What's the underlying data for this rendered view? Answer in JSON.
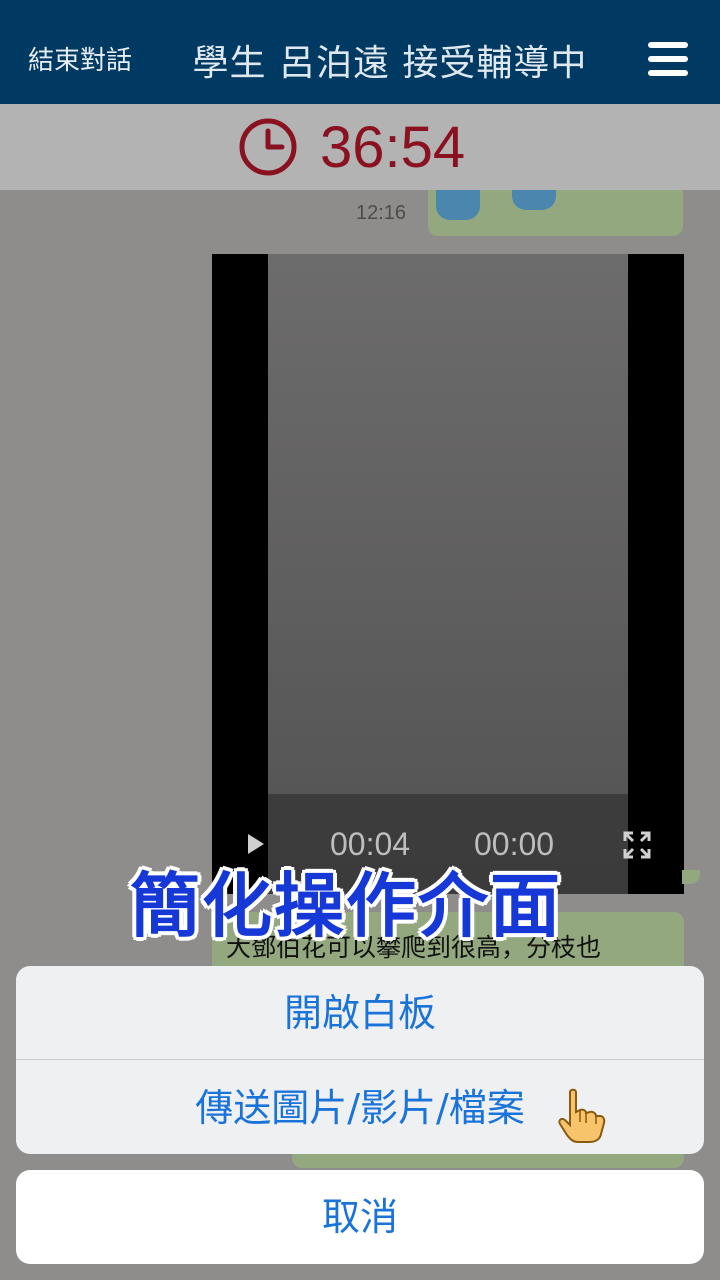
{
  "header": {
    "end_label": "結束對話",
    "title": "學生 呂泊遠 接受輔導中"
  },
  "timer": {
    "value": "36:54",
    "color": "#8a1220"
  },
  "chat": {
    "timestamp": "12:16",
    "video": {
      "elapsed": "00:04",
      "duration": "00:00"
    },
    "message_text": "大鄧伯花可以攀爬到很高，分枝也"
  },
  "overlay": {
    "caption": "簡化操作介面"
  },
  "action_sheet": {
    "option1": "開啟白板",
    "option2": "傳送圖片/影片/檔案",
    "cancel": "取消"
  },
  "colors": {
    "header_bg": "#003a63",
    "accent": "#1a73d9",
    "bubble": "#93a87e"
  },
  "icons": [
    "menu-icon",
    "clock-icon",
    "play-icon",
    "fullscreen-icon",
    "pointing-hand-icon"
  ]
}
